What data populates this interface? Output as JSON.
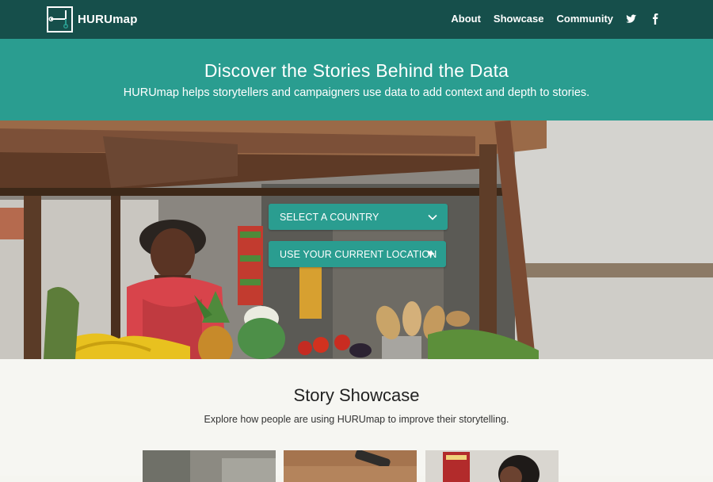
{
  "nav": {
    "brand": "HURUmap",
    "links": [
      "About",
      "Showcase",
      "Community"
    ],
    "icons": [
      "twitter-icon",
      "facebook-icon"
    ]
  },
  "banner": {
    "title": "Discover the Stories Behind the Data",
    "subtitle": "HURUmap helps storytellers and campaigners use data to add context and depth to stories."
  },
  "hero": {
    "select_country": "SELECT A COUNTRY",
    "use_location": "USE YOUR CURRENT LOCATION"
  },
  "showcase": {
    "title": "Story Showcase",
    "subtitle": "Explore how people are using HURUmap to improve their storytelling."
  },
  "colors": {
    "nav_bg": "#164f4b",
    "teal": "#2a9d90",
    "page_bg": "#f6f6f2"
  }
}
